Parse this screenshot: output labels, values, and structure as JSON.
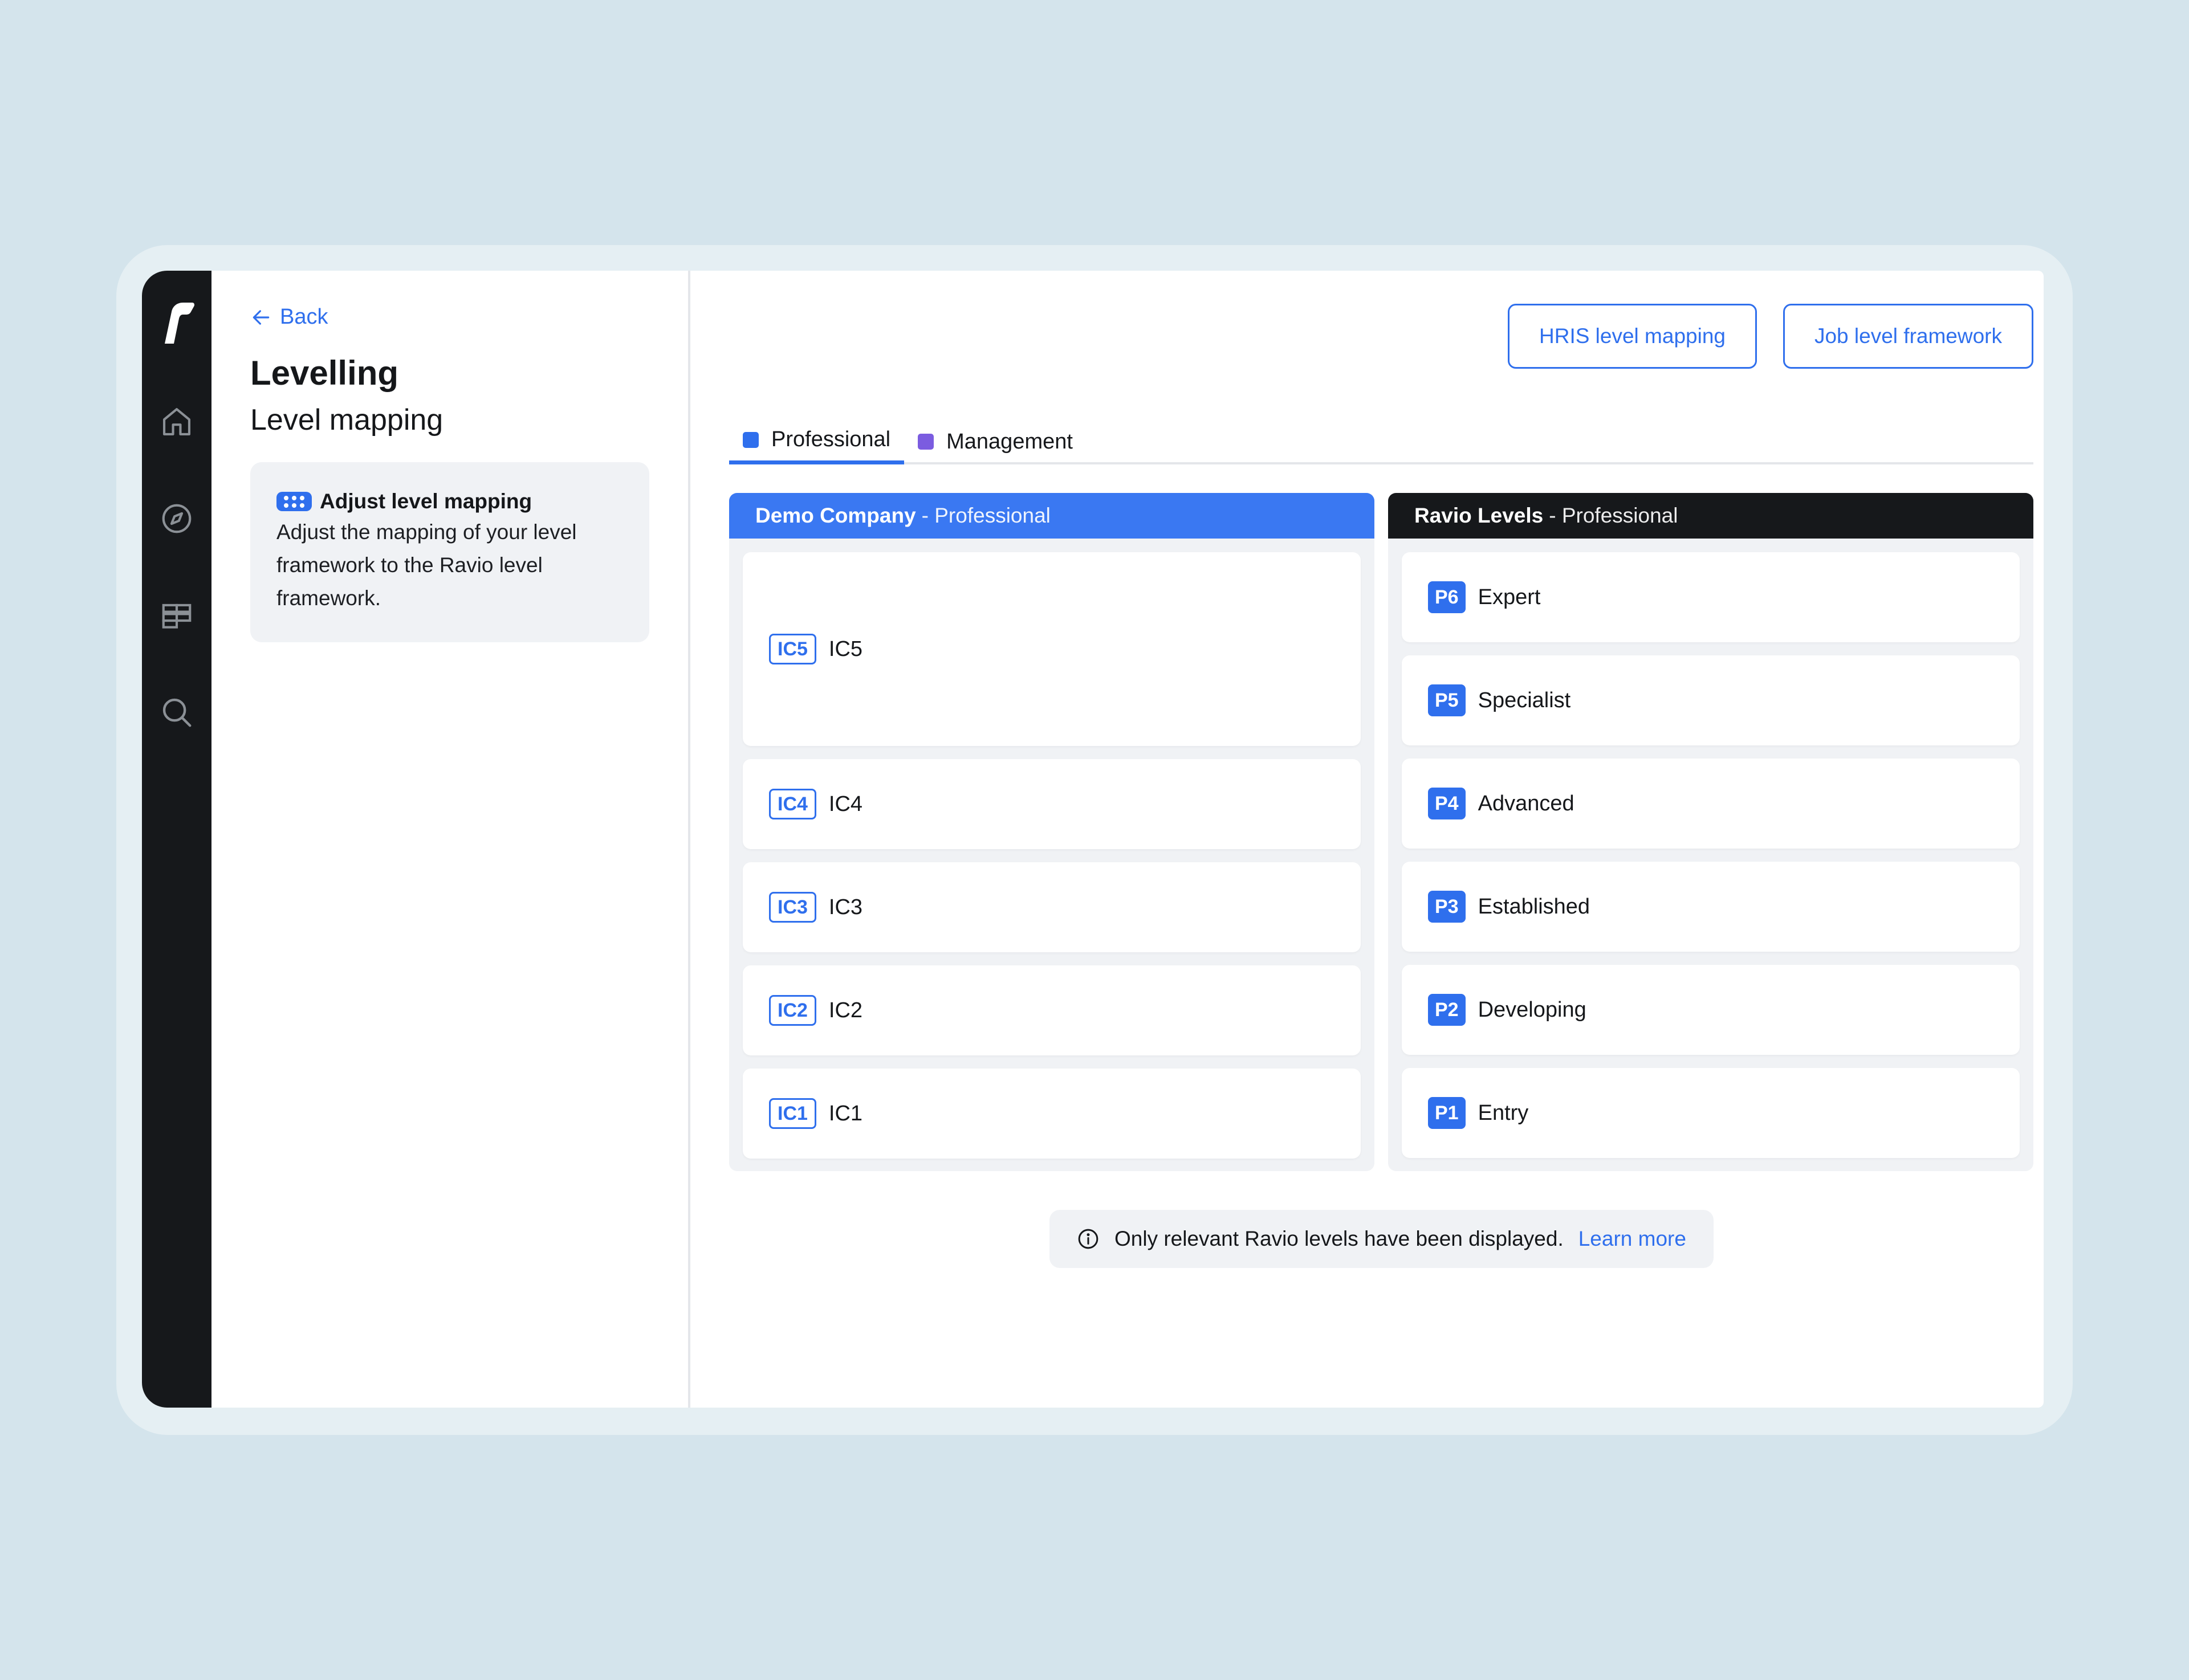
{
  "nav": {
    "back_label": "Back",
    "items": [
      "home-icon",
      "compass-icon",
      "layers-icon",
      "search-icon"
    ]
  },
  "side": {
    "title": "Levelling",
    "subtitle": "Level mapping",
    "card_title": "Adjust level mapping",
    "card_body": "Adjust the mapping of your level framework to the Ravio level framework."
  },
  "toolbar": {
    "hris_label": "HRIS level mapping",
    "framework_label": "Job level framework"
  },
  "tabs": [
    {
      "label": "Professional",
      "color": "#2f6fed",
      "active": true
    },
    {
      "label": "Management",
      "color": "#7b5ce0",
      "active": false
    }
  ],
  "company": {
    "name": "Demo Company",
    "track": "- Professional",
    "header_color": "#3a78f2",
    "levels": [
      {
        "tag": "IC5",
        "label": "IC5"
      },
      {
        "tag": "IC4",
        "label": "IC4"
      },
      {
        "tag": "IC3",
        "label": "IC3"
      },
      {
        "tag": "IC2",
        "label": "IC2"
      },
      {
        "tag": "IC1",
        "label": "IC1"
      }
    ]
  },
  "ravio": {
    "name": "Ravio Levels",
    "track": " - Professional",
    "header_color": "#16181b",
    "levels": [
      {
        "tag": "P6",
        "label": "Expert"
      },
      {
        "tag": "P5",
        "label": "Specialist"
      },
      {
        "tag": "P4",
        "label": "Advanced"
      },
      {
        "tag": "P3",
        "label": "Established"
      },
      {
        "tag": "P2",
        "label": "Developing"
      },
      {
        "tag": "P1",
        "label": "Entry"
      }
    ]
  },
  "notice": {
    "text": "Only relevant Ravio levels have been displayed.",
    "link": "Learn more"
  }
}
